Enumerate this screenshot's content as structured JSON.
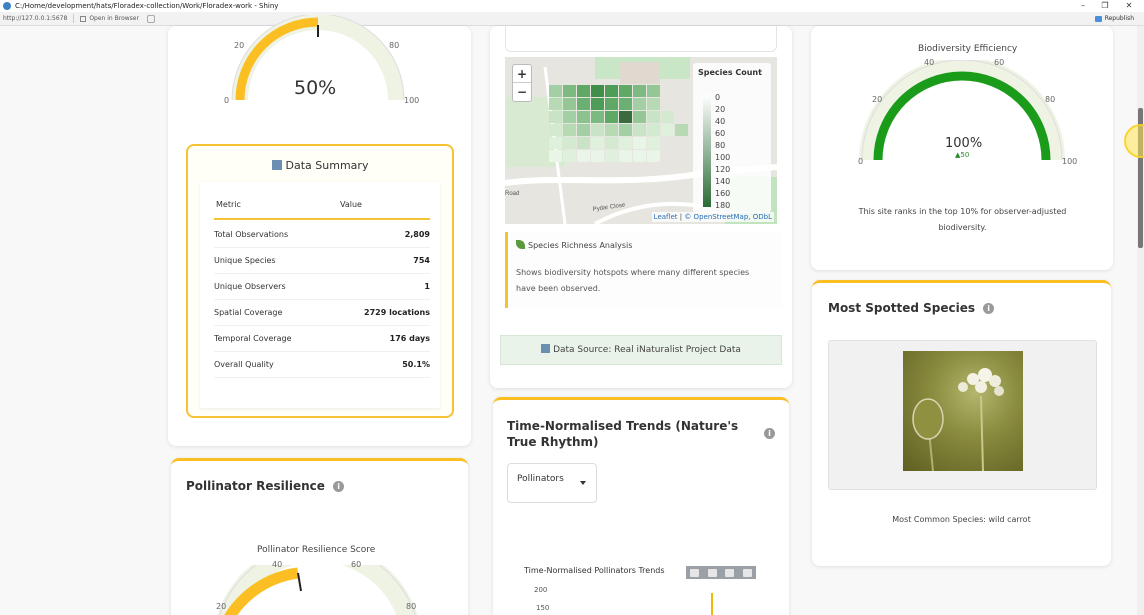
{
  "window": {
    "title": "C:/Home/development/hats/Floradex-collection/Work/Floradex-work - Shiny",
    "url": "http://127.0.0.1:5678",
    "open_in_browser": "Open in Browser",
    "republish": "Republish",
    "controls": [
      "–",
      "❐",
      "✕"
    ]
  },
  "gauge_top": {
    "value_label": "50%",
    "ticks": [
      "0",
      "20",
      "80",
      "100"
    ],
    "value": 50,
    "color": "#fbbf24"
  },
  "data_summary": {
    "title": "Data Summary",
    "headers": [
      "Metric",
      "Value"
    ],
    "rows": [
      {
        "metric": "Total Observations",
        "value": "2,809"
      },
      {
        "metric": "Unique Species",
        "value": "754"
      },
      {
        "metric": "Unique Observers",
        "value": "1"
      },
      {
        "metric": "Spatial Coverage",
        "value": "2729 locations"
      },
      {
        "metric": "Temporal Coverage",
        "value": "176 days"
      },
      {
        "metric": "Overall Quality",
        "value": "50.1%"
      }
    ]
  },
  "pollinator": {
    "heading": "Pollinator Resilience",
    "gauge_title": "Pollinator Resilience Score",
    "ticks": [
      "20",
      "40",
      "60",
      "80"
    ],
    "color": "#fbbf24"
  },
  "map": {
    "zoom_in": "+",
    "zoom_out": "−",
    "legend_title": "Species Count",
    "legend_values": [
      "0",
      "20",
      "40",
      "60",
      "80",
      "100",
      "120",
      "140",
      "160",
      "180"
    ],
    "attribution_leaflet": "Leaflet",
    "attribution_rest": "© OpenStreetMap, ODbL",
    "street_labels": [
      "Road",
      "Pydar Close"
    ]
  },
  "analysis": {
    "title": "Species Richness Analysis",
    "description": "Shows biodiversity hotspots where many different species have been observed."
  },
  "data_source": "Data Source: Real iNaturalist Project Data",
  "trends": {
    "heading": "Time-Normalised Trends (Nature's True Rhythm)",
    "select_value": "Pollinators",
    "chart_title": "Time-Normalised Pollinators Trends",
    "y_tick": "200",
    "y_tick2": "150"
  },
  "efficiency": {
    "title": "Biodiversity Efficiency",
    "value_label": "100%",
    "delta": "▲50",
    "value": 100,
    "ticks": [
      "0",
      "20",
      "40",
      "60",
      "80",
      "100"
    ],
    "color": "#1a9c1a",
    "note": "This site ranks in the top 10% for observer-adjusted biodiversity."
  },
  "most_spotted": {
    "heading": "Most Spotted Species",
    "caption": "Most Common Species: wild carrot"
  }
}
